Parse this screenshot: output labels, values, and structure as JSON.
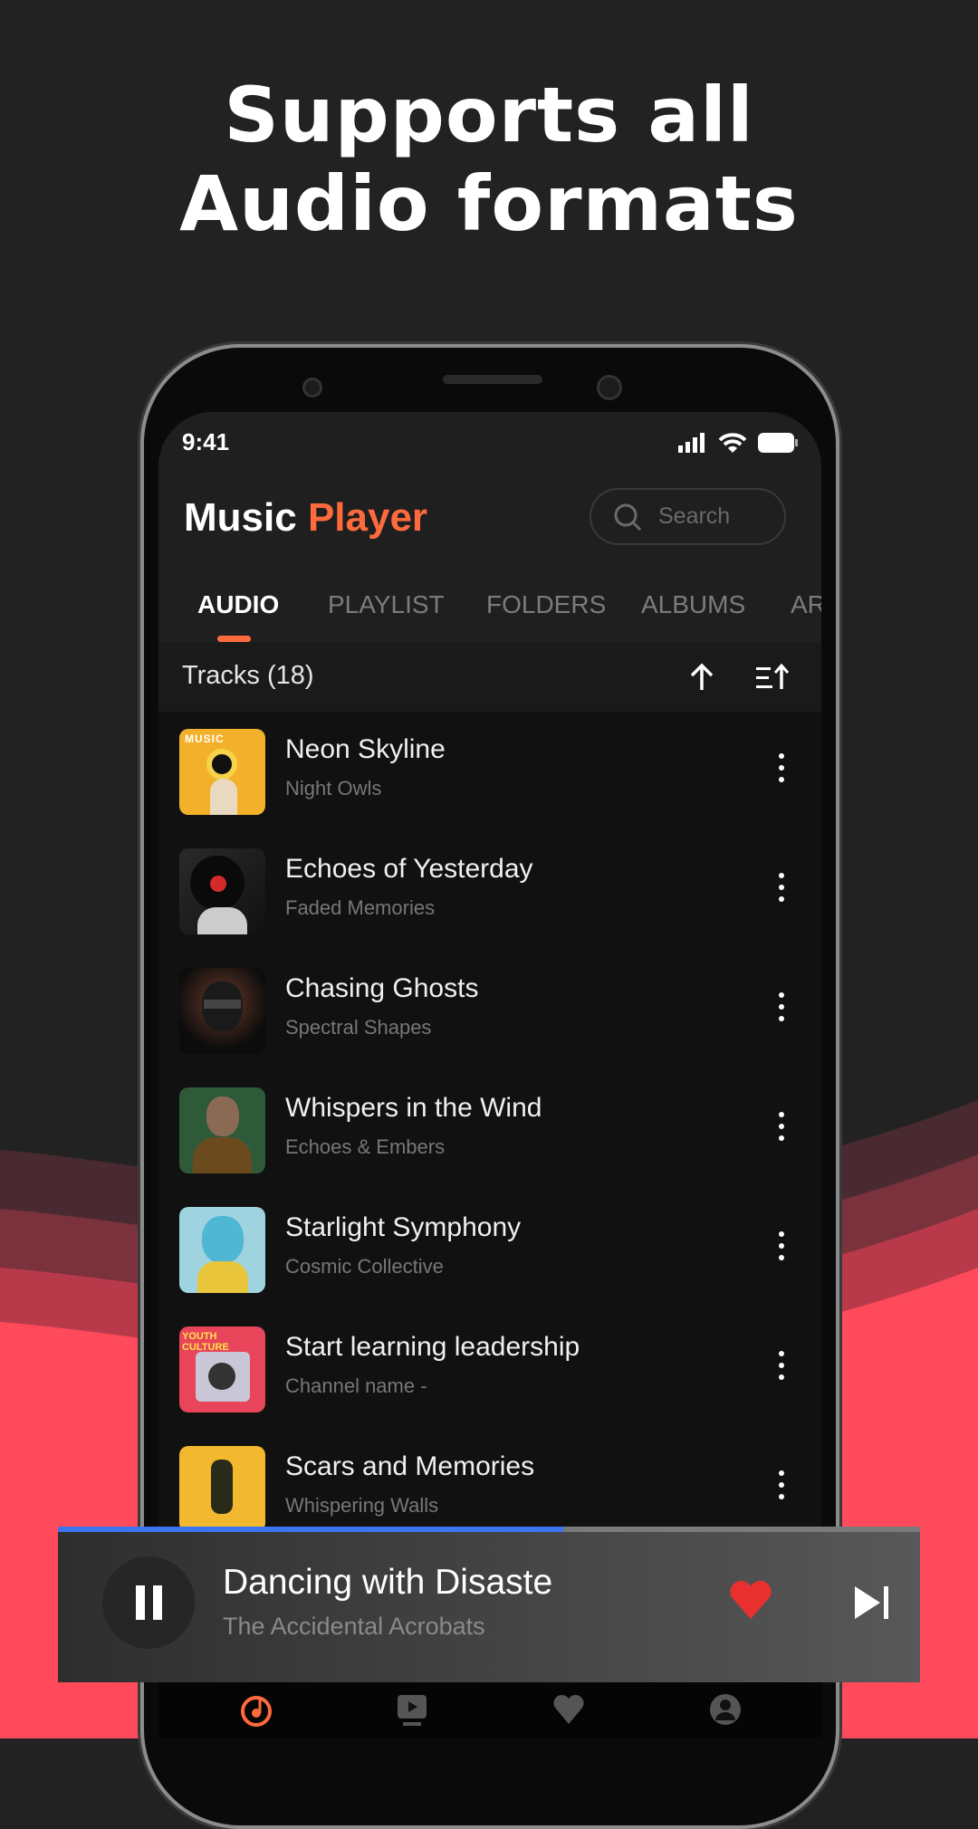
{
  "headline": {
    "line1": "Supports all",
    "line2": "Audio formats"
  },
  "colors": {
    "accent": "#ff6a3d",
    "progress": "#3d74f0",
    "heart": "#e8312f",
    "wave": "#ff4a5c"
  },
  "status": {
    "time": "9:41",
    "icons": [
      "signal-icon",
      "wifi-icon",
      "battery-icon"
    ]
  },
  "app": {
    "title_part1": "Music",
    "title_part2": "Player",
    "search_placeholder": "Search"
  },
  "tabs": [
    {
      "label": "AUDIO",
      "active": true
    },
    {
      "label": "PLAYLIST"
    },
    {
      "label": "FOLDERS"
    },
    {
      "label": "ALBUMS"
    },
    {
      "label": "AR"
    }
  ],
  "tracks": {
    "label": "Tracks (18)",
    "items": [
      {
        "title": "Neon Skyline",
        "artist": "Night Owls"
      },
      {
        "title": "Echoes of Yesterday",
        "artist": "Faded Memories"
      },
      {
        "title": "Chasing Ghosts",
        "artist": "Spectral Shapes"
      },
      {
        "title": "Whispers in the Wind",
        "artist": "Echoes & Embers"
      },
      {
        "title": "Starlight Symphony",
        "artist": "Cosmic Collective"
      },
      {
        "title": "Start learning leadership",
        "artist": "Channel name -"
      },
      {
        "title": "Scars and Memories",
        "artist": "Whispering Walls"
      }
    ]
  },
  "thumb_text": {
    "t0": "MUSIC",
    "t5": "YOUTH CULTURE"
  },
  "now_playing": {
    "title": "Dancing with Disaste",
    "artist": "The Accidental Acrobats",
    "progress": 0.586,
    "liked": true
  },
  "bottom_nav": [
    {
      "icon": "music-disc-icon",
      "active": true
    },
    {
      "icon": "video-icon"
    },
    {
      "icon": "heart-icon"
    },
    {
      "icon": "profile-icon"
    }
  ]
}
